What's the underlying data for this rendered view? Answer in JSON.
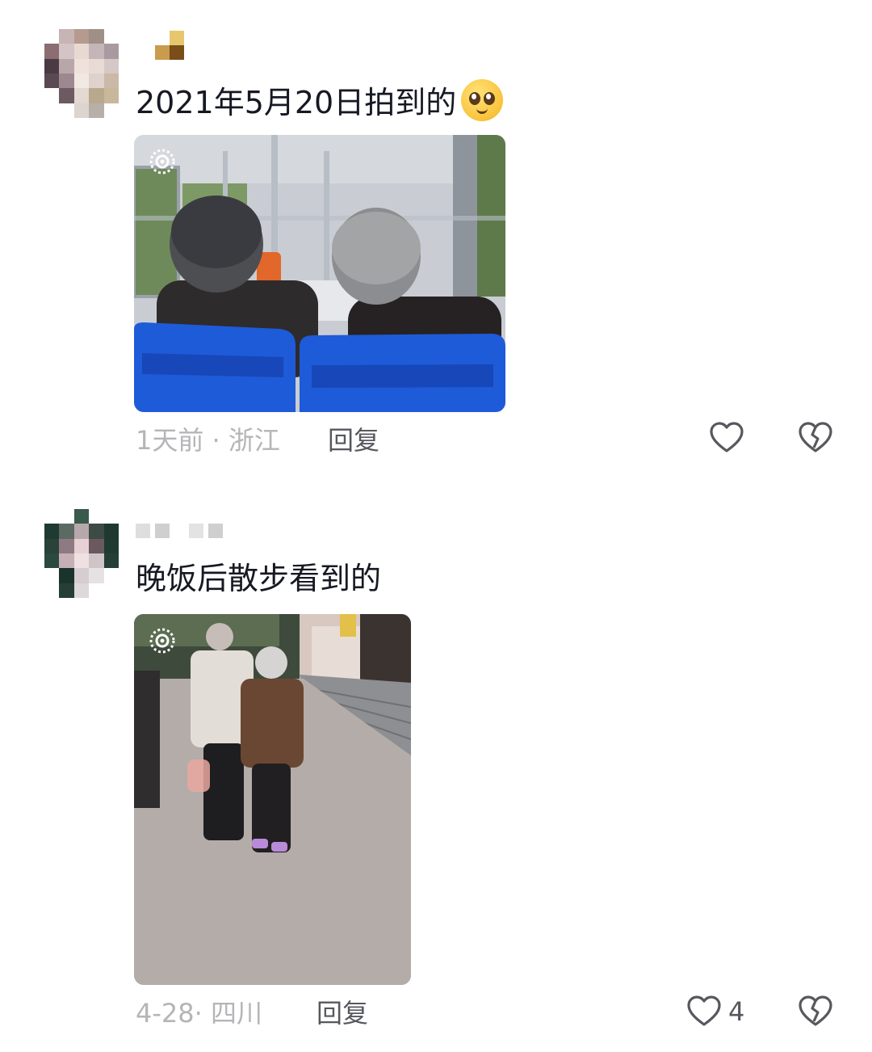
{
  "comments": [
    {
      "text": "2021年5月20日拍到的",
      "emoji": "pleading-face",
      "time": "1天前",
      "location": "浙江",
      "reply_label": "回复",
      "like_count": "",
      "photo": "Elderly couple seated on blue bus seats"
    },
    {
      "text": "晚饭后散步看到的",
      "emoji": "",
      "time": "4-28",
      "location": "四川",
      "reply_label": "回复",
      "like_count": "4",
      "photo": "Elderly couple walking arm in arm on a sidewalk"
    }
  ],
  "colors": {
    "text": "#161823",
    "meta": "#b5b5b8",
    "action": "#57585e",
    "bus_seat": "#1e5bd9"
  }
}
